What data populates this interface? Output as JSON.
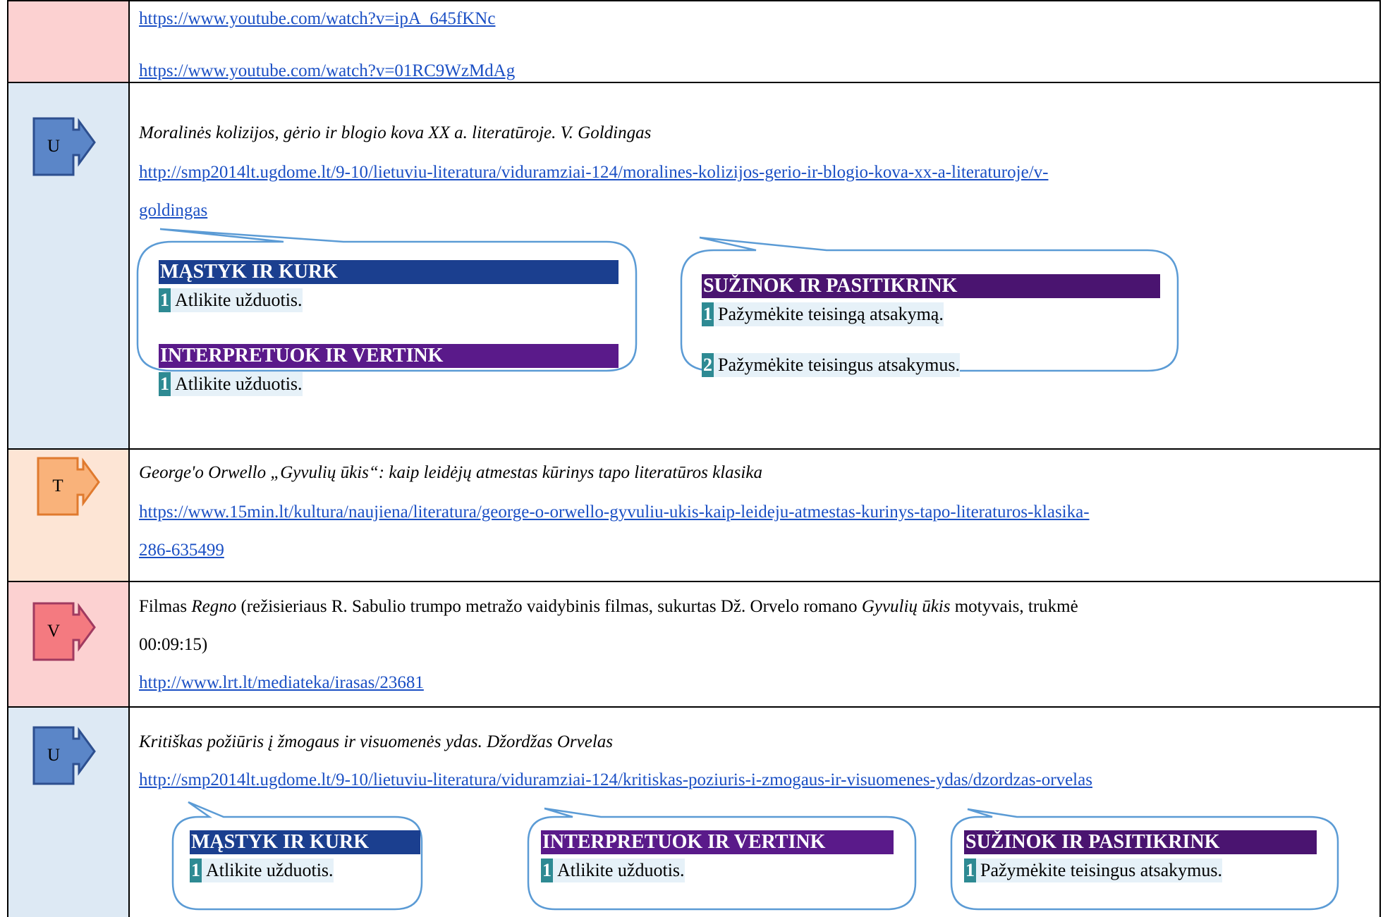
{
  "rows": [
    {
      "links": [
        "https://www.youtube.com/watch?v=ipA_645fKNc",
        "https://www.youtube.com/watch?v=01RC9WzMdAg"
      ]
    },
    {
      "badge": "U",
      "title": "Moralinės kolizijos, gėrio ir blogio kova XX a. literatūroje. V. Goldingas",
      "link_line1": "http://smp2014lt.ugdome.lt/9-10/lietuviu-literatura/viduramziai-124/moralines-kolizijos-gerio-ir-blogio-kova-xx-a-literaturoje/v-",
      "link_line2": "goldingas",
      "box1": {
        "h1": "MĄSTYK IR KURK",
        "t1_num": "1",
        "t1": "Atlikite užduotis.",
        "h2": "INTERPRETUOK IR VERTINK",
        "t2_num": "1",
        "t2": "Atlikite užduotis."
      },
      "box2": {
        "h1": "SUŽINOK IR PASITIKRINK",
        "t1_num": "1",
        "t1": "Pažymėkite teisingą atsakymą.",
        "t2_num": "2",
        "t2": "Pažymėkite teisingus atsakymus."
      }
    },
    {
      "badge": "T",
      "title": "George'o Orwello „Gyvulių ūkis“: kaip leidėjų atmestas kūrinys tapo literatūros klasika",
      "link_line1": "https://www.15min.lt/kultura/naujiena/literatura/george-o-orwello-gyvuliu-ukis-kaip-leideju-atmestas-kurinys-tapo-literaturos-klasika-",
      "link_line2": "286-635499"
    },
    {
      "badge": "V",
      "text_a": "Filmas ",
      "text_b": "Regno",
      "text_c": " (režisieriaus R. Sabulio trumpo metražo vaidybinis filmas, sukurtas Dž. Orvelo romano ",
      "text_d": "Gyvulių ūkis",
      "text_e": " motyvais, trukmė",
      "text_line2": "00:09:15)",
      "link": "http://www.lrt.lt/mediateka/irasas/23681"
    },
    {
      "badge": "U",
      "title": "Kritiškas požiūris į žmogaus ir visuomenės ydas. Džordžas Orvelas",
      "link": "http://smp2014lt.ugdome.lt/9-10/lietuviu-literatura/viduramziai-124/kritiskas-poziuris-i-zmogaus-ir-visuomenes-ydas/dzordzas-orvelas",
      "box1": {
        "h": "MĄSTYK IR KURK",
        "num": "1",
        "t": "Atlikite užduotis."
      },
      "box2": {
        "h": "INTERPRETUOK IR VERTINK",
        "num": "1",
        "t": "Atlikite užduotis."
      },
      "box3": {
        "h": "SUŽINOK IR PASITIKRINK",
        "num": "1",
        "t": "Pažymėkite teisingus atsakymus."
      }
    }
  ],
  "colors": {
    "row_pink": "#fcd1d1",
    "row_blue": "#dde9f4",
    "row_peach": "#fde5d5",
    "badge_blue": "#5b86c8",
    "badge_orange": "#f9b27a",
    "badge_red": "#f47a80",
    "hdr_blue": "#1b3f8f",
    "hdr_purple": "#5a1a8a",
    "hdr_darkpurple": "#4a1470",
    "callout_border": "#5b9bd5",
    "link": "#1a4fc4"
  }
}
